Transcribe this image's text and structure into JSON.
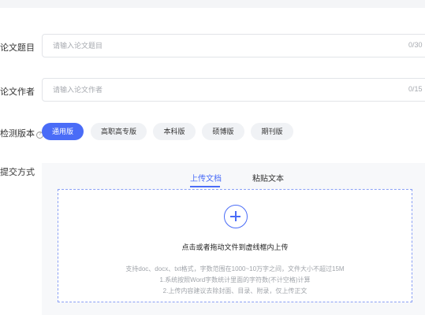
{
  "form": {
    "title_field": {
      "label": "论文题目",
      "placeholder": "请输入论文题目",
      "counter": "0/30"
    },
    "author_field": {
      "label": "论文作者",
      "placeholder": "请输入论文作者",
      "counter": "0/15"
    },
    "version": {
      "label": "检测版本",
      "help_icon": "?",
      "options": [
        "通用版",
        "高职高专版",
        "本科版",
        "硕博版",
        "期刊版"
      ],
      "selected": "通用版"
    },
    "submit": {
      "label": "提交方式",
      "tabs": [
        "上传文档",
        "粘贴文本"
      ],
      "active_tab": "上传文档",
      "dropzone": {
        "icon": "plus-circle-icon",
        "main_text": "点击或者拖动文件到虚线框内上传",
        "hint1": "支持doc、docx、txt格式，字数范围在1000~10万字之间，文件大小不超过15M",
        "hint2": "1.系统按照Word字数统计里面的字符数(不计空格)计算",
        "hint3": "2.上传内容建议去除封面、目录、附录，仅上传正文"
      }
    }
  },
  "colors": {
    "accent": "#4a6cf7",
    "pill_bg": "#f0f2f5",
    "panel_bg": "#f7f8fa",
    "border": "#e2e4e8",
    "placeholder": "#a6a9af"
  }
}
